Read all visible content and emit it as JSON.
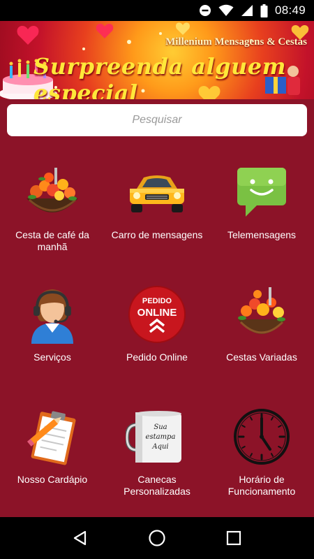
{
  "status_bar": {
    "time": "08:49",
    "icons": [
      "do-not-disturb-icon",
      "wifi-icon",
      "signal-icon",
      "battery-icon"
    ]
  },
  "banner": {
    "brand": "Millenium Mensagens & Cestas",
    "tagline": "Surpreenda alguem especial"
  },
  "search": {
    "placeholder": "Pesquisar",
    "value": ""
  },
  "menu": {
    "items": [
      {
        "label": "Cesta de café da manhã",
        "icon": "flower-basket-icon"
      },
      {
        "label": "Carro de mensagens",
        "icon": "car-icon"
      },
      {
        "label": "Telemensagens",
        "icon": "chat-bubble-icon"
      },
      {
        "label": "Serviços",
        "icon": "support-agent-icon"
      },
      {
        "label": "Pedido Online",
        "icon": "order-online-icon",
        "badge_top": "PEDIDO",
        "badge_main": "ONLINE"
      },
      {
        "label": "Cestas Variadas",
        "icon": "gift-basket-icon"
      },
      {
        "label": "Nosso Cardápio",
        "icon": "clipboard-pencil-icon"
      },
      {
        "label": "Canecas Personalizadas",
        "icon": "mug-icon",
        "mug_text": "Sua estampa Aqui"
      },
      {
        "label": "Horário de Funcionamento",
        "icon": "clock-icon"
      }
    ]
  },
  "nav_bar": {
    "buttons": [
      "back-icon",
      "home-icon",
      "recents-icon"
    ]
  },
  "colors": {
    "background": "#8c1328",
    "search_bg": "#ffffff",
    "label_text": "#ffffff",
    "system_bars": "#000000"
  }
}
